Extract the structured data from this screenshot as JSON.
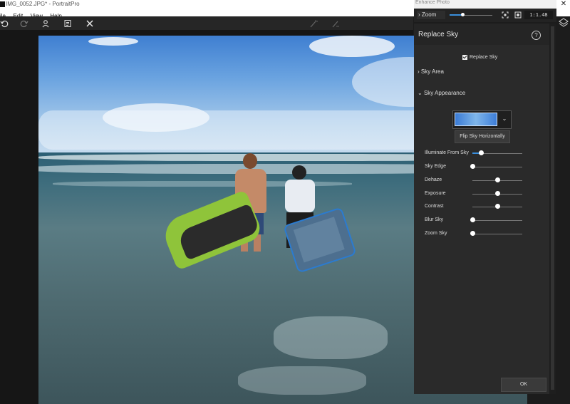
{
  "window": {
    "title": "IMG_0052.JPG* - PortraitPro"
  },
  "menu": {
    "items": [
      "ile",
      "Edit",
      "View",
      "Help"
    ]
  },
  "toolbar": {
    "tools": [
      "undo-icon",
      "redo-icon",
      "person-icon",
      "notes-icon",
      "close-icon",
      "wand-icon",
      "wand-alt-icon"
    ]
  },
  "enhance": {
    "title": "Enhance Photo"
  },
  "zoom": {
    "label": "Zoom",
    "level": 0.3,
    "value": "1:1.48"
  },
  "panel": {
    "title": "Replace Sky",
    "replace_sky_label": "Replace Sky",
    "replace_sky_checked": true,
    "sky_area": "Sky Area",
    "sky_appearance": "Sky Appearance",
    "flip_label": "Flip Sky Horizontally",
    "sliders": [
      {
        "label": "Illuminate From Sky",
        "value": 0.18,
        "bipolar": false
      },
      {
        "label": "Sky Edge",
        "value": 0.0,
        "bipolar": false
      },
      {
        "label": "Dehaze",
        "value": 0.5,
        "bipolar": true
      },
      {
        "label": "Exposure",
        "value": 0.5,
        "bipolar": true
      },
      {
        "label": "Contrast",
        "value": 0.5,
        "bipolar": true
      },
      {
        "label": "Blur Sky",
        "value": 0.0,
        "bipolar": false
      },
      {
        "label": "Zoom Sky",
        "value": 0.0,
        "bipolar": false
      }
    ],
    "ok_label": "OK"
  },
  "colors": {
    "accent": "#3a8fdc",
    "panel": "#2a2a2a",
    "toolbar": "#262626"
  }
}
